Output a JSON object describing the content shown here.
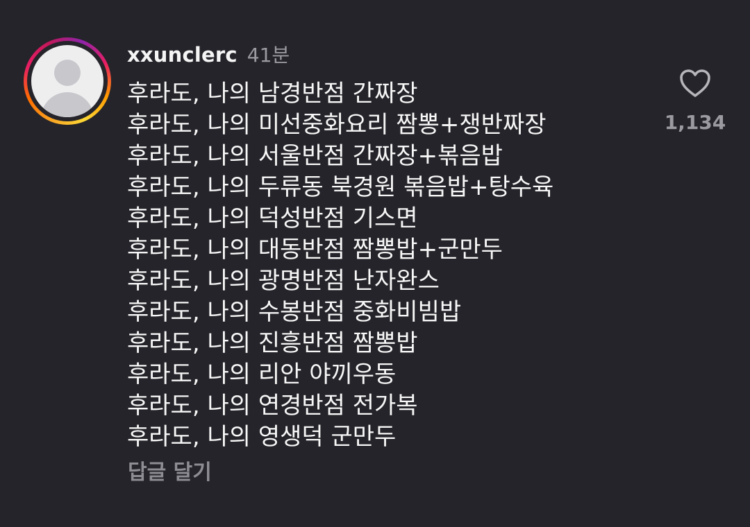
{
  "comment": {
    "username": "xxunclerc",
    "time": "41분",
    "avatar_icon": "default-profile-icon",
    "lines": [
      "후라도, 나의 남경반점 간짜장",
      "후라도, 나의 미선중화요리 짬뽕+쟁반짜장",
      "후라도, 나의 서울반점 간짜장+볶음밥",
      "후라도, 나의 두류동 북경원 볶음밥+탕수육",
      "후라도, 나의 덕성반점 기스면",
      "후라도, 나의 대동반점 짬뽕밥+군만두",
      "후라도, 나의 광명반점 난자완스",
      "후라도, 나의 수봉반점 중화비빔밥",
      "후라도, 나의 진흥반점 짬뽕밥",
      "후라도, 나의 리안 야끼우동",
      "후라도, 나의 연경반점 전가복",
      "후라도, 나의 영생덕 군만두"
    ],
    "reply_label": "답글 달기",
    "like_icon": "heart-outline-icon",
    "like_count": "1,134"
  },
  "colors": {
    "background": "#25242a",
    "text": "#f7f7f7",
    "muted": "#9a9aa0",
    "story_ring": [
      "#f9a825",
      "#e91e63",
      "#8e24aa"
    ]
  }
}
